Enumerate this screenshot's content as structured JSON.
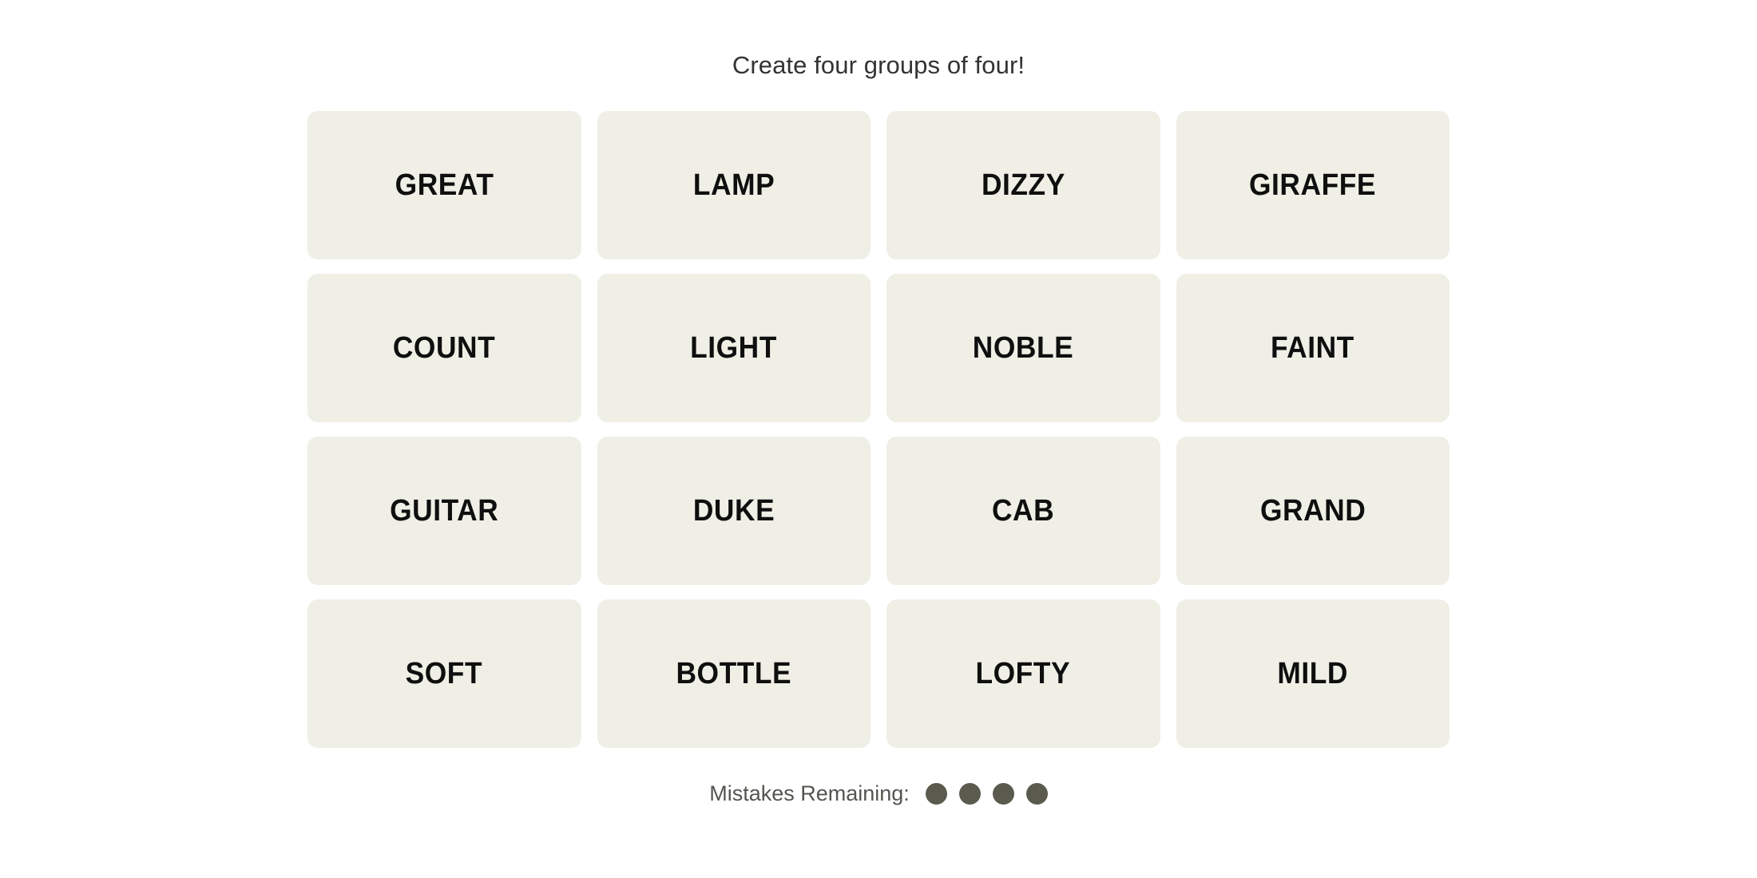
{
  "header": {
    "instruction": "Create four groups of four!"
  },
  "board": {
    "rows": 4,
    "columns": 4,
    "tile_color": "#EFEFE6",
    "tile_text_color": "#0F0F0F",
    "tiles": [
      {
        "label": "GREAT"
      },
      {
        "label": "LAMP"
      },
      {
        "label": "DIZZY"
      },
      {
        "label": "GIRAFFE"
      },
      {
        "label": "COUNT"
      },
      {
        "label": "LIGHT"
      },
      {
        "label": "NOBLE"
      },
      {
        "label": "FAINT"
      },
      {
        "label": "GUITAR"
      },
      {
        "label": "DUKE"
      },
      {
        "label": "CAB"
      },
      {
        "label": "GRAND"
      },
      {
        "label": "SOFT"
      },
      {
        "label": "BOTTLE"
      },
      {
        "label": "LOFTY"
      },
      {
        "label": "MILD"
      }
    ]
  },
  "footer": {
    "mistakes_label": "Mistakes Remaining:",
    "mistakes_remaining": 4,
    "dot_color": "#5A5A4E",
    "dots": [
      {
        "name": "mistake-dot-1"
      },
      {
        "name": "mistake-dot-2"
      },
      {
        "name": "mistake-dot-3"
      },
      {
        "name": "mistake-dot-4"
      }
    ]
  }
}
